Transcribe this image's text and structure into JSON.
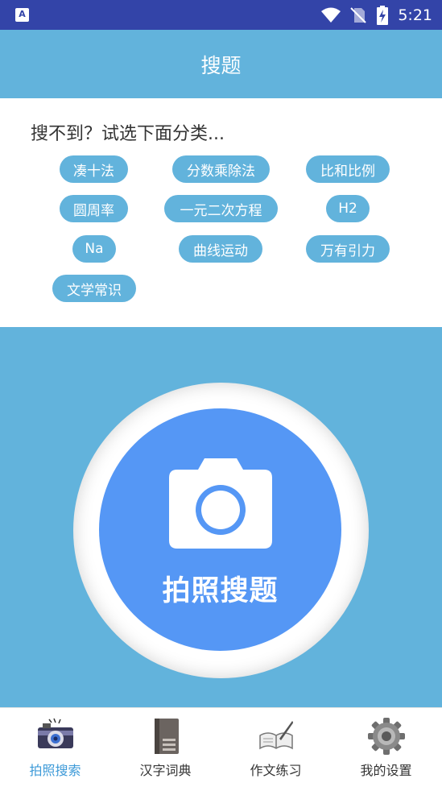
{
  "status_bar": {
    "app_icon_letter": "A",
    "time": "5:21",
    "icons": [
      "wifi-icon",
      "no-sim-icon",
      "battery-charging-icon"
    ]
  },
  "app_bar": {
    "title": "搜题"
  },
  "categories": {
    "heading": "搜不到？试选下面分类...",
    "tags": [
      "凑十法",
      "分数乘除法",
      "比和比例",
      "圆周率",
      "一元二次方程",
      "H2",
      "Na",
      "曲线运动",
      "万有引力",
      "文学常识"
    ]
  },
  "camera": {
    "label": "拍照搜题",
    "icon": "camera-icon"
  },
  "bottom_nav": {
    "items": [
      {
        "label": "拍照搜索",
        "icon": "camera-photo-icon",
        "active": true
      },
      {
        "label": "汉字词典",
        "icon": "book-icon",
        "active": false
      },
      {
        "label": "作文练习",
        "icon": "open-book-quill-icon",
        "active": false
      },
      {
        "label": "我的设置",
        "icon": "gear-icon",
        "active": false
      }
    ]
  },
  "colors": {
    "status_bar": "#3344a8",
    "primary": "#62b3dc",
    "camera_button": "#5597f5",
    "nav_active": "#3d9ad8"
  }
}
